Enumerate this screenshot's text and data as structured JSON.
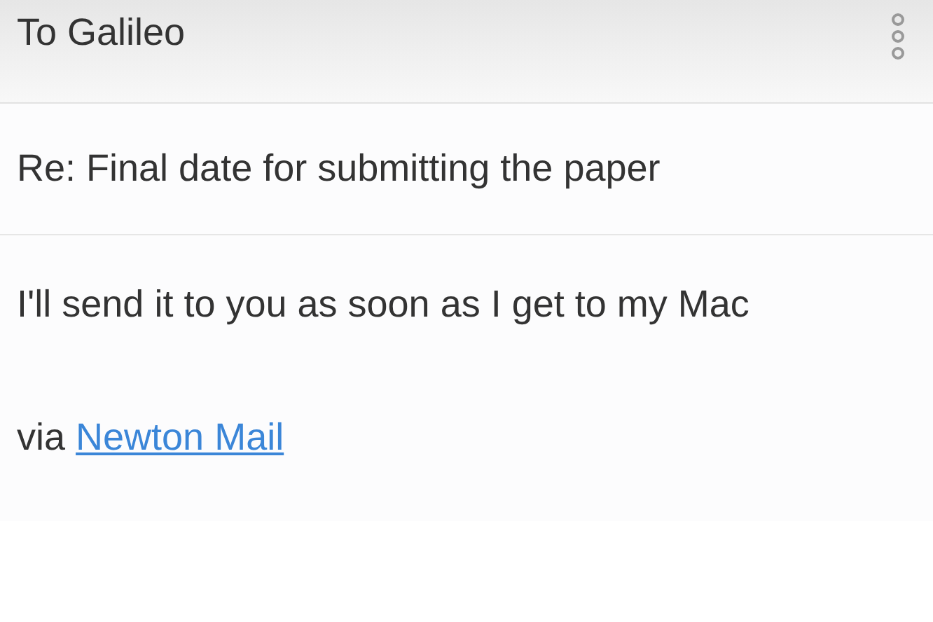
{
  "header": {
    "recipient": "To Galileo"
  },
  "subject": "Re: Final date for submitting the paper",
  "body": "I'll send it to you as soon as I get to my Mac",
  "signature": {
    "prefix": "via",
    "link": "Newton Mail"
  }
}
